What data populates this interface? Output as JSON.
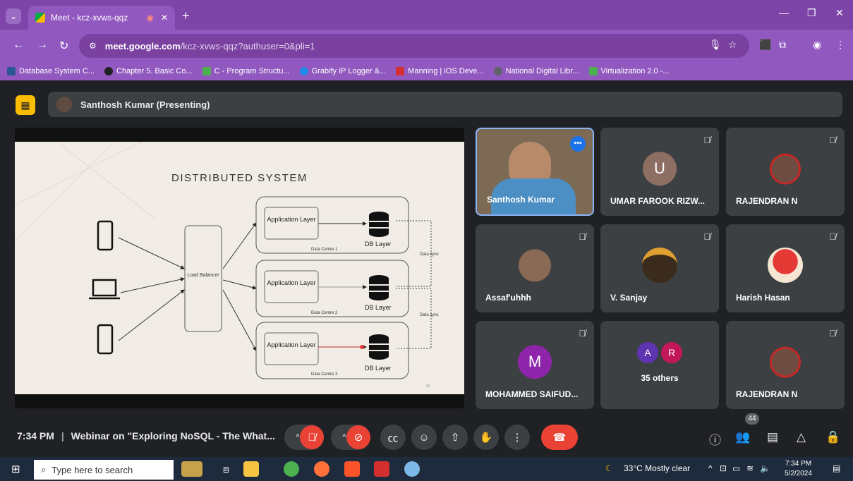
{
  "browser": {
    "tab_title": "Meet - kcz-xvws-qqz",
    "url_domain": "meet.google.com",
    "url_path": "/kcz-xvws-qqz?authuser=0&pli=1",
    "bookmarks": [
      {
        "label": "Database System C...",
        "color": "#2b5797"
      },
      {
        "label": "Chapter 5. Basic Co...",
        "color": "#202124"
      },
      {
        "label": "C - Program Structu...",
        "color": "#4caf50"
      },
      {
        "label": "Grabify IP Logger &...",
        "color": "#1e88e5"
      },
      {
        "label": "Manning | iOS Deve...",
        "color": "#d32f2f"
      },
      {
        "label": "National Digital Libr...",
        "color": "#5f6368"
      },
      {
        "label": "Virtualization 2.0 -...",
        "color": "#4caf50"
      }
    ]
  },
  "presenter_bar": {
    "label": "Santhosh Kumar (Presenting)"
  },
  "slide": {
    "title": "DISTRIBUTED SYSTEM",
    "load_balancer": "Load Balancer",
    "centres": [
      {
        "app": "Application Layer",
        "db": "DB Layer",
        "centre": "Data Centre 1"
      },
      {
        "app": "Application Layer",
        "db": "DB Layer",
        "centre": "Data Centre 2"
      },
      {
        "app": "Application Layer",
        "db": "DB Layer",
        "centre": "Data Centre 3"
      }
    ],
    "sync_labels": [
      "Data sync",
      "Data sync"
    ],
    "page_no": "20"
  },
  "participants": [
    {
      "name": "Santhosh Kumar"
    },
    {
      "name": "UMAR FAROOK RIZW...",
      "letter": "U",
      "color": "#8d6e63"
    },
    {
      "name": "RAJENDRAN N"
    },
    {
      "name": "Assaf'uhhh"
    },
    {
      "name": "V. Sanjay"
    },
    {
      "name": "Harish Hasan"
    },
    {
      "name": "MOHAMMED SAIFUD...",
      "letter": "M",
      "color": "#8e24aa"
    },
    {
      "name": "35 others",
      "letters": [
        "A",
        "R"
      ]
    },
    {
      "name": "RAJENDRAN N"
    }
  ],
  "controls": {
    "time": "7:34 PM",
    "separator": "|",
    "meeting_title": "Webinar on \"Exploring NoSQL - The What...",
    "people_count": "44"
  },
  "taskbar": {
    "search_placeholder": "Type here to search",
    "weather": "33°C  Mostly clear",
    "clock_time": "7:34 PM",
    "clock_date": "5/2/2024"
  },
  "colors": {
    "chrome_purple": "#9159bf",
    "meet_bg": "#202124",
    "tile_bg": "#3c4043",
    "end_call": "#ea4335"
  }
}
